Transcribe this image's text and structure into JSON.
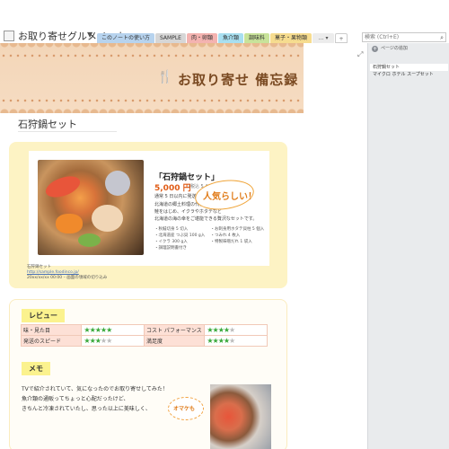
{
  "notebook": {
    "title": "お取り寄せグルメノート",
    "caret": "▼"
  },
  "tabs": [
    {
      "label": "このノートの使い方",
      "color": "#b7d3ee"
    },
    {
      "label": "SAMPLE",
      "color": "#d6d6d6"
    },
    {
      "label": "肉・卵類",
      "color": "#f4b3b0"
    },
    {
      "label": "魚介類",
      "color": "#a8dff0"
    },
    {
      "label": "調味料",
      "color": "#c8e39a"
    },
    {
      "label": "菓子・果物類",
      "color": "#f6dc8f"
    }
  ],
  "more_label": "… ▾",
  "add_label": "+",
  "search": {
    "placeholder": "検索 (Ctrl+E)",
    "icon": "search-icon"
  },
  "banner": {
    "title": "お取り寄せ 備忘録"
  },
  "page": {
    "title": "石狩鍋セット"
  },
  "product": {
    "name": "「石狩鍋セット」",
    "price": "5,000 円",
    "price_note": "(税込 5,400 円) 送料込",
    "shipping": "通常 5 日以内に発送",
    "desc": [
      "北海道の郷土料理の代名詞！",
      "鮭をはじめ、イクラやホタテなど",
      "北海道の海の幸をご堪能できる贅沢なセットです。"
    ],
    "specs": [
      "・秋鮭切身 5 切入",
      "・お刺身用ホタテ貝柱 5 個入",
      "・北海道産 つぶ貝 100 g入",
      "・つみれ 4 枚入",
      "・イクラ 300 g入",
      "・特製味噌だれ 1 袋入",
      "・調理説明書付き",
      ""
    ]
  },
  "sticker": "人気らしい！",
  "caption": {
    "line1": "石狩鍋セット",
    "url": "http://sample.foodinco.jp/",
    "line3": "20xx/xx/xx 00:00 – 画面の領域の切り込み"
  },
  "review": {
    "label": "レビュー",
    "rows": [
      {
        "k1": "味・見た目",
        "s1": 5,
        "k2": "コスト パフォーマンス",
        "s2": 4
      },
      {
        "k1": "発送のスピード",
        "s1": 3,
        "k2": "満足度",
        "s2": 4
      }
    ]
  },
  "memo": {
    "label": "メモ",
    "lines": [
      "TVで紹介されていて、気になったのでお取り寄せしてみた！",
      "魚介類の通販ってちょっと心配だったけど、",
      "きちんと冷凍されていたし、思った以上に美味しく、"
    ],
    "bubble": "オマケも"
  },
  "pane": {
    "add_label": "ページの追加",
    "items": [
      "石狩鍋セット",
      "マイクロ ホテル スープセット"
    ]
  },
  "colors": {
    "accent": "#e05b15",
    "card": "#fdf3c4",
    "tag": "#fbf28e",
    "star": "#39a83a"
  }
}
